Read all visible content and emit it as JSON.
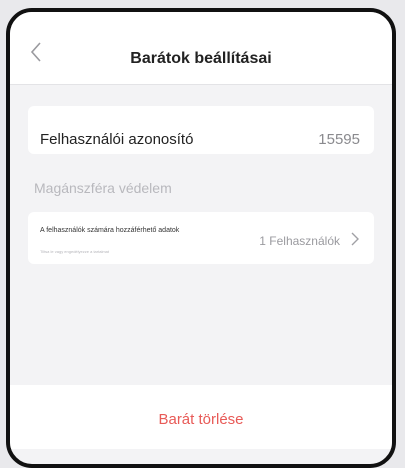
{
  "header": {
    "title": "Barátok beállításai"
  },
  "user_id": {
    "label": "Felhasználói azonosító",
    "value": "15595"
  },
  "privacy": {
    "section_title": "Magánszféra védelem",
    "item_label": "A felhasználók számára hozzáférhető adatok",
    "item_description": "Tiltsa le vagy engedélyezze a tartalmat",
    "item_value": "1 Felhasználók"
  },
  "actions": {
    "delete_label": "Barát törlése"
  },
  "colors": {
    "danger": "#e85a57",
    "muted": "#9a9a9f"
  },
  "icons": {
    "back": "chevron-left-icon",
    "row": "chevron-right-icon"
  }
}
